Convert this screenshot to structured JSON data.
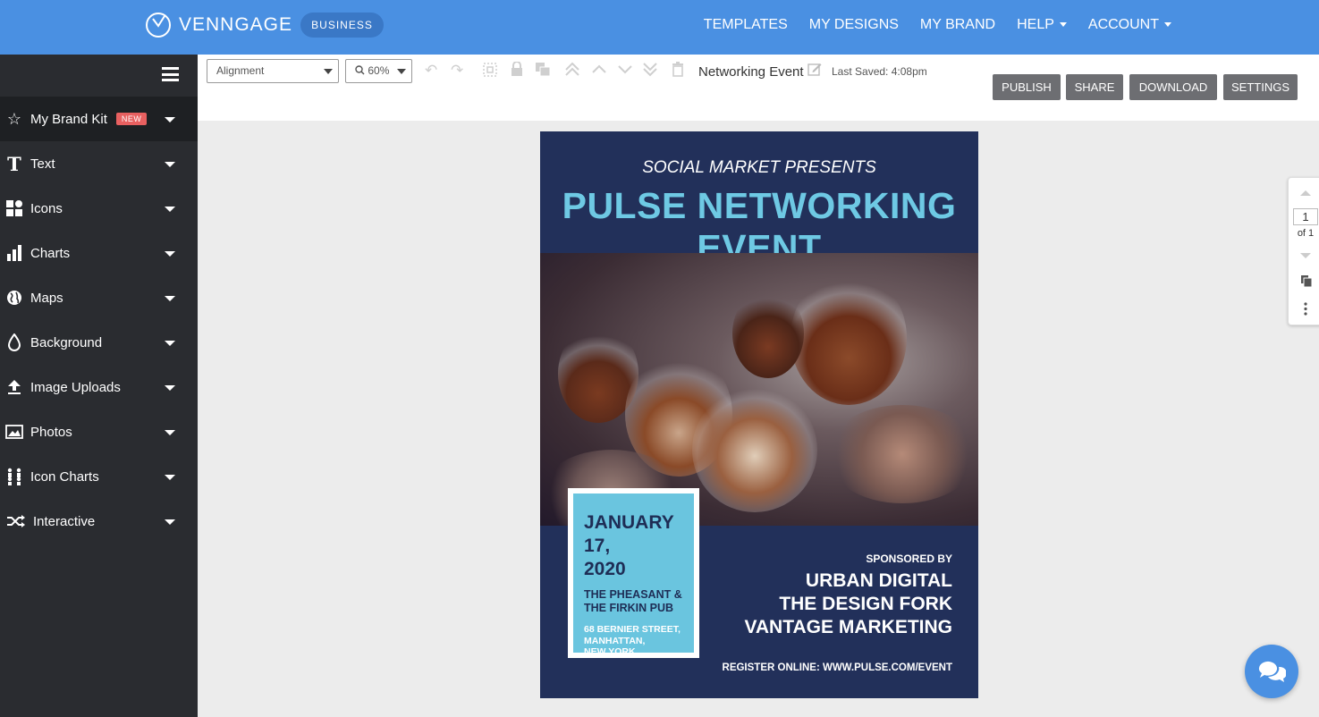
{
  "topbar": {
    "brand": "VENNGAGE",
    "plan_badge": "BUSINESS",
    "nav": [
      {
        "label": "TEMPLATES",
        "has_caret": false
      },
      {
        "label": "MY DESIGNS",
        "has_caret": false
      },
      {
        "label": "MY BRAND",
        "has_caret": false
      },
      {
        "label": "HELP",
        "has_caret": true
      },
      {
        "label": "ACCOUNT",
        "has_caret": true
      }
    ]
  },
  "sidebar": {
    "items": [
      {
        "label": "My Brand Kit",
        "icon": "star-icon",
        "badge": "NEW"
      },
      {
        "label": "Text",
        "icon": "text-icon"
      },
      {
        "label": "Icons",
        "icon": "shapes-icon"
      },
      {
        "label": "Charts",
        "icon": "bar-chart-icon"
      },
      {
        "label": "Maps",
        "icon": "globe-icon"
      },
      {
        "label": "Background",
        "icon": "droplet-icon"
      },
      {
        "label": "Image Uploads",
        "icon": "upload-icon"
      },
      {
        "label": "Photos",
        "icon": "photo-icon"
      },
      {
        "label": "Icon Charts",
        "icon": "people-icon"
      },
      {
        "label": "Interactive",
        "icon": "shuffle-icon"
      }
    ]
  },
  "toolbar": {
    "alignment_value": "Alignment",
    "zoom_value": "60%",
    "doc_title": "Networking Event",
    "last_saved": "Last Saved: 4:08pm",
    "buttons": {
      "publish": "PUBLISH",
      "share": "SHARE",
      "download": "DOWNLOAD",
      "settings": "SETTINGS"
    }
  },
  "pagenav": {
    "current": "1",
    "of_label": "of 1"
  },
  "poster": {
    "subtitle": "SOCIAL MARKET PRESENTS",
    "headline": "PULSE NETWORKING EVENT",
    "date_line1": "JANUARY 17,",
    "date_line2": "2020",
    "venue_line1": "THE PHEASANT &",
    "venue_line2": "THE FIRKIN PUB",
    "address_line1": "68 BERNIER STREET,",
    "address_line2": "MANHATTAN,",
    "address_line3": "NEW YORK",
    "sponsored_by": "SPONSORED BY",
    "sponsors": [
      "URBAN DIGITAL",
      "THE DESIGN FORK",
      "VANTAGE MARKETING"
    ],
    "register": "REGISTER ONLINE: WWW.PULSE.COM/EVENT"
  },
  "colors": {
    "topbar": "#4a90e2",
    "sidebar": "#2a2c30",
    "poster_bg": "#22305a",
    "headline": "#6ec9e4",
    "datebox": "#6ac5df"
  }
}
